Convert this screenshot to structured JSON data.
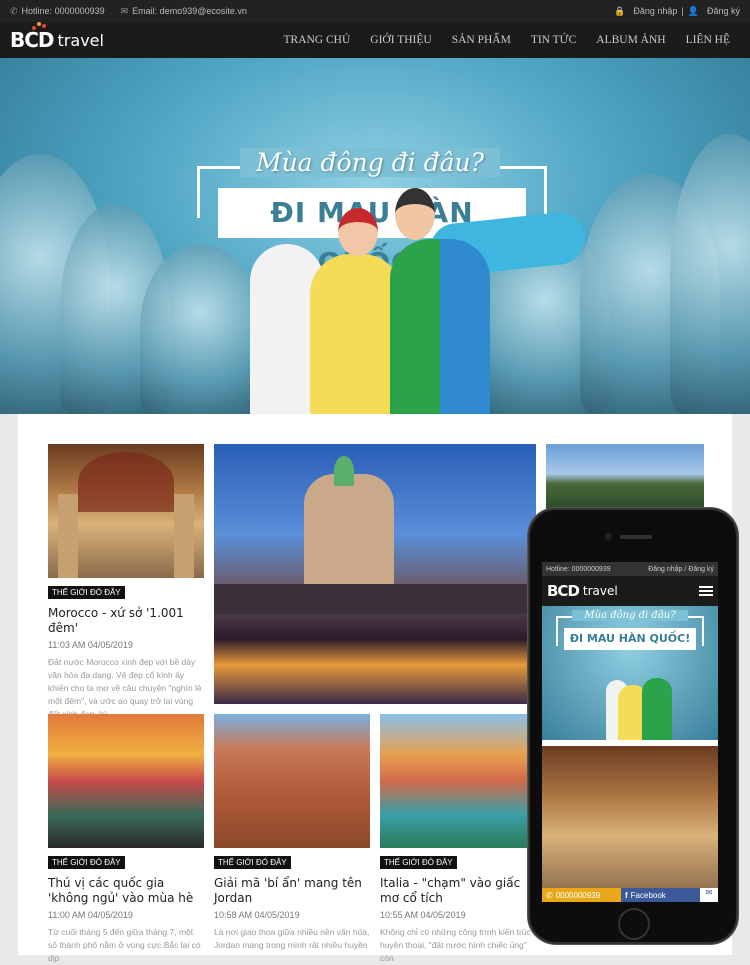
{
  "topbar": {
    "hotline": "Hotline: 0000000939",
    "email": "Email: demo939@ecosite.vn",
    "login": "Đăng nhập",
    "register": "Đăng ký"
  },
  "logo": {
    "brand": "BCD",
    "suffix": "travel"
  },
  "nav": [
    "TRANG CHỦ",
    "GIỚI THIỆU",
    "SẢN PHẨM",
    "TIN TỨC",
    "ALBUM ẢNH",
    "LIÊN HỆ"
  ],
  "hero": {
    "script": "Mùa đông đi đâu?",
    "banner": "ĐI MAU HÀN QUỐC!"
  },
  "articles": [
    {
      "tag": "THẾ GIỚI ĐÓ ĐÂY",
      "title": "Morocco - xứ sở '1.001 đêm'",
      "date": "11:03 AM 04/05/2019",
      "excerpt": "Đất nước Morocco xinh đẹp với bề dày văn hóa đa dạng. Vẻ đẹp cổ kính ấy khiến cho ta mơ về câu chuyện \"nghìn lẻ một đêm\", và ước ao quay trở lại vùng đất xinh đẹp, kỳ"
    },
    {
      "tag": "THẾ GIỚI ĐÓ ĐÂY",
      "title": "Thú vị các quốc gia 'không ngủ' vào mùa hè",
      "date": "11:00 AM 04/05/2019",
      "excerpt": "Từ cuối tháng 5 đến giữa tháng 7, một số thành phố nằm ở vùng cực Bắc lại có dịp"
    },
    {
      "tag": "THẾ GIỚI ĐÓ ĐÂY",
      "title": "Giải mã 'bí ẩn' mang tên Jordan",
      "date": "10:58 AM 04/05/2019",
      "excerpt": "Là nơi giao thoa giữa nhiều nền văn hóa, Jordan mang trong mình rất nhiều huyền"
    },
    {
      "tag": "THẾ GIỚI ĐÓ ĐÂY",
      "title": "Italia - \"chạm\" vào giấc mơ cổ tích",
      "date": "10:55 AM 04/05/2019",
      "excerpt": "Không chỉ có những công trình kiến trúc huyền thoại, \"đất nước hình chiếc ủng\" còn"
    }
  ],
  "mobile": {
    "hotline": "Hotline: 0000000939",
    "login": "Đăng nhập",
    "register": "Đăng ký",
    "hero_script": "Mùa đông đi đâu?",
    "hero_banner": "ĐI MAU HÀN QUỐC!",
    "phone_btn": "0000000939",
    "facebook_btn": "Facebook"
  },
  "colors": {
    "accent": "#e8452c",
    "brand_dark": "#1b1b1b"
  }
}
